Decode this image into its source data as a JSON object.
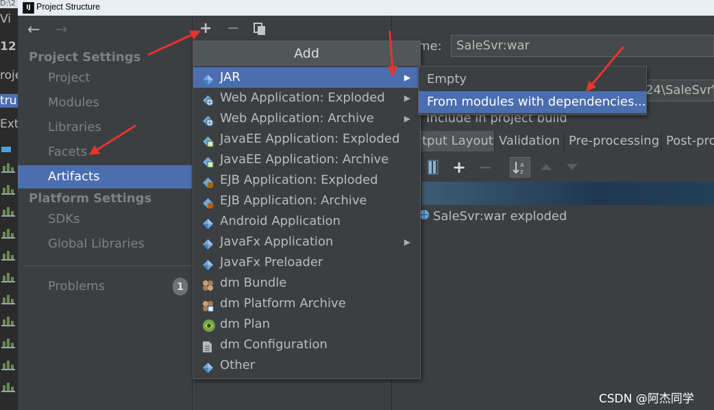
{
  "window": {
    "title": "Project Structure",
    "app_icon": "IJ"
  },
  "background_strip": {
    "texts": [
      "D:\\2",
      "Vi",
      "12",
      "roje",
      "tru",
      "Ext"
    ]
  },
  "left_panel": {
    "nav": {
      "back_icon": "arrow-left-icon",
      "forward_icon": "arrow-right-icon"
    },
    "project_settings_header": "Project Settings",
    "project_settings_items": [
      "Project",
      "Modules",
      "Libraries",
      "Facets",
      "Artifacts"
    ],
    "selected_item": "Artifacts",
    "platform_settings_header": "Platform Settings",
    "platform_settings_items": [
      "SDKs",
      "Global Libraries"
    ],
    "problems_label": "Problems",
    "problems_count": "1"
  },
  "middle_toolbar": {
    "add": "+",
    "remove": "−",
    "copy_icon": "copy-icon"
  },
  "add_menu": {
    "header": "Add",
    "items": [
      {
        "label": "JAR",
        "icon": "artifact-icon",
        "submenu": true,
        "selected": true
      },
      {
        "label": "Web Application: Exploded",
        "icon": "web-artifact-icon",
        "submenu": true
      },
      {
        "label": "Web Application: Archive",
        "icon": "web-artifact-icon",
        "submenu": true
      },
      {
        "label": "JavaEE Application: Exploded",
        "icon": "javaee-artifact-icon",
        "submenu": false
      },
      {
        "label": "JavaEE Application: Archive",
        "icon": "javaee-artifact-icon",
        "submenu": false
      },
      {
        "label": "EJB Application: Exploded",
        "icon": "ejb-artifact-icon",
        "submenu": false
      },
      {
        "label": "EJB Application: Archive",
        "icon": "ejb-artifact-icon",
        "submenu": false
      },
      {
        "label": "Android Application",
        "icon": "artifact-icon",
        "submenu": false
      },
      {
        "label": "JavaFx Application",
        "icon": "artifact-icon",
        "submenu": true
      },
      {
        "label": "JavaFx Preloader",
        "icon": "artifact-icon",
        "submenu": false
      },
      {
        "label": "dm Bundle",
        "icon": "bundle-icon",
        "submenu": false
      },
      {
        "label": "dm Platform Archive",
        "icon": "platform-archive-icon",
        "submenu": false
      },
      {
        "label": "dm Plan",
        "icon": "plan-icon",
        "submenu": false
      },
      {
        "label": "dm Configuration",
        "icon": "file-icon",
        "submenu": false
      },
      {
        "label": "Other",
        "icon": "artifact-icon",
        "submenu": false
      }
    ]
  },
  "jar_submenu": {
    "items": [
      {
        "label": "Empty",
        "selected": false
      },
      {
        "label": "From modules with dependencies...",
        "selected": true
      }
    ]
  },
  "artifact_editor": {
    "name_label": "me:",
    "name_value": "SaleSvr:war",
    "output_dir_value": "24\\SaleSvr\\t",
    "include_in_build_label": "Include in project build",
    "tabs": [
      "tput Layout",
      "Validation",
      "Pre-processing",
      "Post-pro"
    ],
    "active_tab": "tput Layout",
    "tree_item": "SaleSvr:war exploded"
  },
  "watermark": "CSDN @阿杰同学",
  "colors": {
    "selection": "#4b6eaf",
    "panel": "#3c3f41",
    "annotation": "#e8332e"
  }
}
